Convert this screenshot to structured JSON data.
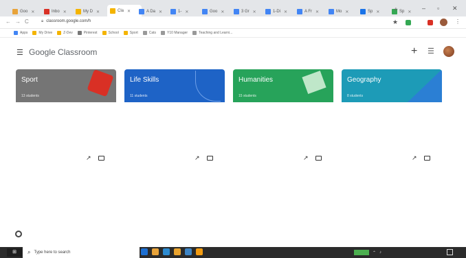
{
  "browser": {
    "tabs": [
      {
        "label": "Goo",
        "color": "#e8a33a"
      },
      {
        "label": "Inbo",
        "color": "#d93025"
      },
      {
        "label": "My D",
        "color": "#f4b400"
      },
      {
        "label": "Cla",
        "color": "#f4b400",
        "active": true
      },
      {
        "label": "A Da",
        "color": "#4285f4"
      },
      {
        "label": "1-",
        "color": "#4285f4"
      },
      {
        "label": "Goo",
        "color": "#4285f4"
      },
      {
        "label": "3 Gr",
        "color": "#4285f4"
      },
      {
        "label": "1-Di",
        "color": "#4285f4"
      },
      {
        "label": "A Fr",
        "color": "#4285f4"
      },
      {
        "label": "Mo",
        "color": "#4285f4"
      },
      {
        "label": "Sp",
        "color": "#1a73e8"
      },
      {
        "label": "Sp",
        "color": "#34a853"
      }
    ],
    "url": "classroom.google.com/h",
    "bookmarks": [
      {
        "label": "Apps",
        "color": "#4285f4"
      },
      {
        "label": "My Drive",
        "color": "#f4b400"
      },
      {
        "label": "Z-Dev",
        "color": "#f4b400"
      },
      {
        "label": "Pinterest",
        "color": "#777"
      },
      {
        "label": "School",
        "color": "#f4b400"
      },
      {
        "label": "Sport",
        "color": "#f4b400"
      },
      {
        "label": "Cats",
        "color": "#999"
      },
      {
        "label": "Y10 Manager",
        "color": "#999"
      },
      {
        "label": "Teaching and Learni...",
        "color": "#999"
      }
    ]
  },
  "classroom": {
    "brand_google": "Google",
    "brand_product": "Classroom",
    "cards": [
      {
        "title": "Sport",
        "subtitle": "13 students",
        "color": "#757575",
        "deco": "#d93025"
      },
      {
        "title": "Life Skills",
        "subtitle": "11 students",
        "color": "#1e63c6",
        "deco": "#6ea0e8"
      },
      {
        "title": "Humanities",
        "subtitle": "15 students",
        "color": "#27a35a",
        "deco": "#bfe7c9"
      },
      {
        "title": "Geography",
        "subtitle": "8 students",
        "color": "#1d9bb7",
        "deco": "#2b7fd4"
      }
    ]
  },
  "taskbar": {
    "search_placeholder": "Type here to search",
    "apps": [
      "#1d6fd1",
      "#e8a33a",
      "#2d8bd0",
      "#eaa42f",
      "#3e85c5",
      "#f39c12"
    ]
  }
}
